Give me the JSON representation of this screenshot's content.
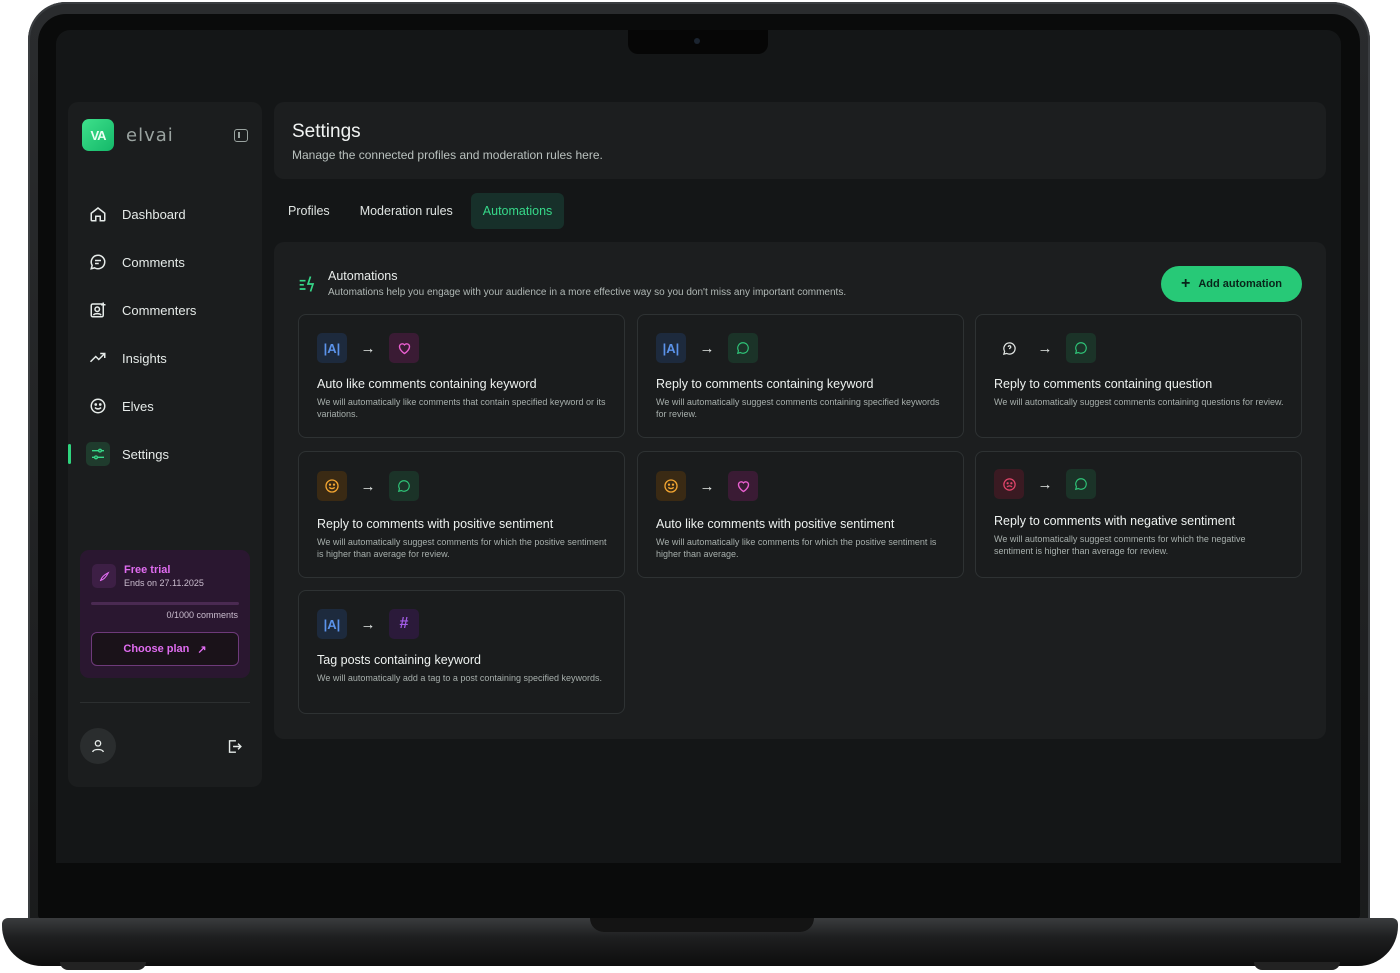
{
  "app": {
    "logo_mark": "VA",
    "logo_name": "elvai"
  },
  "sidebar": {
    "items": [
      {
        "label": "Dashboard",
        "icon": "home-icon",
        "active": false
      },
      {
        "label": "Comments",
        "icon": "comment-icon",
        "active": false
      },
      {
        "label": "Commenters",
        "icon": "user-add-icon",
        "active": false
      },
      {
        "label": "Insights",
        "icon": "trend-up-icon",
        "active": false
      },
      {
        "label": "Elves",
        "icon": "smiley-icon",
        "active": false
      },
      {
        "label": "Settings",
        "icon": "sliders-icon",
        "active": true
      }
    ],
    "trial": {
      "title": "Free trial",
      "ends": "Ends on 27.11.2025",
      "count": "0/1000 comments",
      "progress": 0,
      "button": "Choose plan"
    }
  },
  "header": {
    "title": "Settings",
    "subtitle": "Manage the connected profiles and moderation rules here."
  },
  "tabs": [
    {
      "label": "Profiles",
      "active": false
    },
    {
      "label": "Moderation rules",
      "active": false
    },
    {
      "label": "Automations",
      "active": true
    }
  ],
  "panel": {
    "title": "Automations",
    "subtitle": "Automations help you engage with your audience in a more effective way so you don't miss any important comments.",
    "add_button": "Add automation"
  },
  "cards": [
    {
      "title": "Auto like comments containing keyword",
      "desc": "We will automatically like comments that contain specified keyword or its variations.",
      "from": "keyword-icon",
      "to": "heart-icon"
    },
    {
      "title": "Reply to comments containing keyword",
      "desc": "We will automatically suggest comments containing specified keywords for review.",
      "from": "keyword-icon",
      "to": "reply-icon"
    },
    {
      "title": "Reply to comments containing question",
      "desc": "We will automatically suggest comments containing questions for review.",
      "from": "question-icon",
      "to": "reply-icon"
    },
    {
      "title": "Reply to comments with positive sentiment",
      "desc": "We will automatically suggest comments for which the positive sentiment is higher than average for review.",
      "from": "happy-face-icon",
      "to": "reply-icon"
    },
    {
      "title": "Auto like comments with positive sentiment",
      "desc": "We will automatically like comments for which the positive sentiment is higher than average.",
      "from": "happy-face-icon",
      "to": "heart-icon"
    },
    {
      "title": "Reply to comments with negative sentiment",
      "desc": "We will automatically suggest comments for which the negative sentiment is higher than average for review.",
      "from": "sad-face-icon",
      "to": "reply-icon"
    },
    {
      "title": "Tag posts containing keyword",
      "desc": "We will automatically add a tag to a post containing specified keywords.",
      "from": "keyword-icon",
      "to": "hashtag-icon"
    }
  ],
  "colors": {
    "accent": "#27c977",
    "trial_accent": "#e06cf0",
    "background": "#141617"
  }
}
